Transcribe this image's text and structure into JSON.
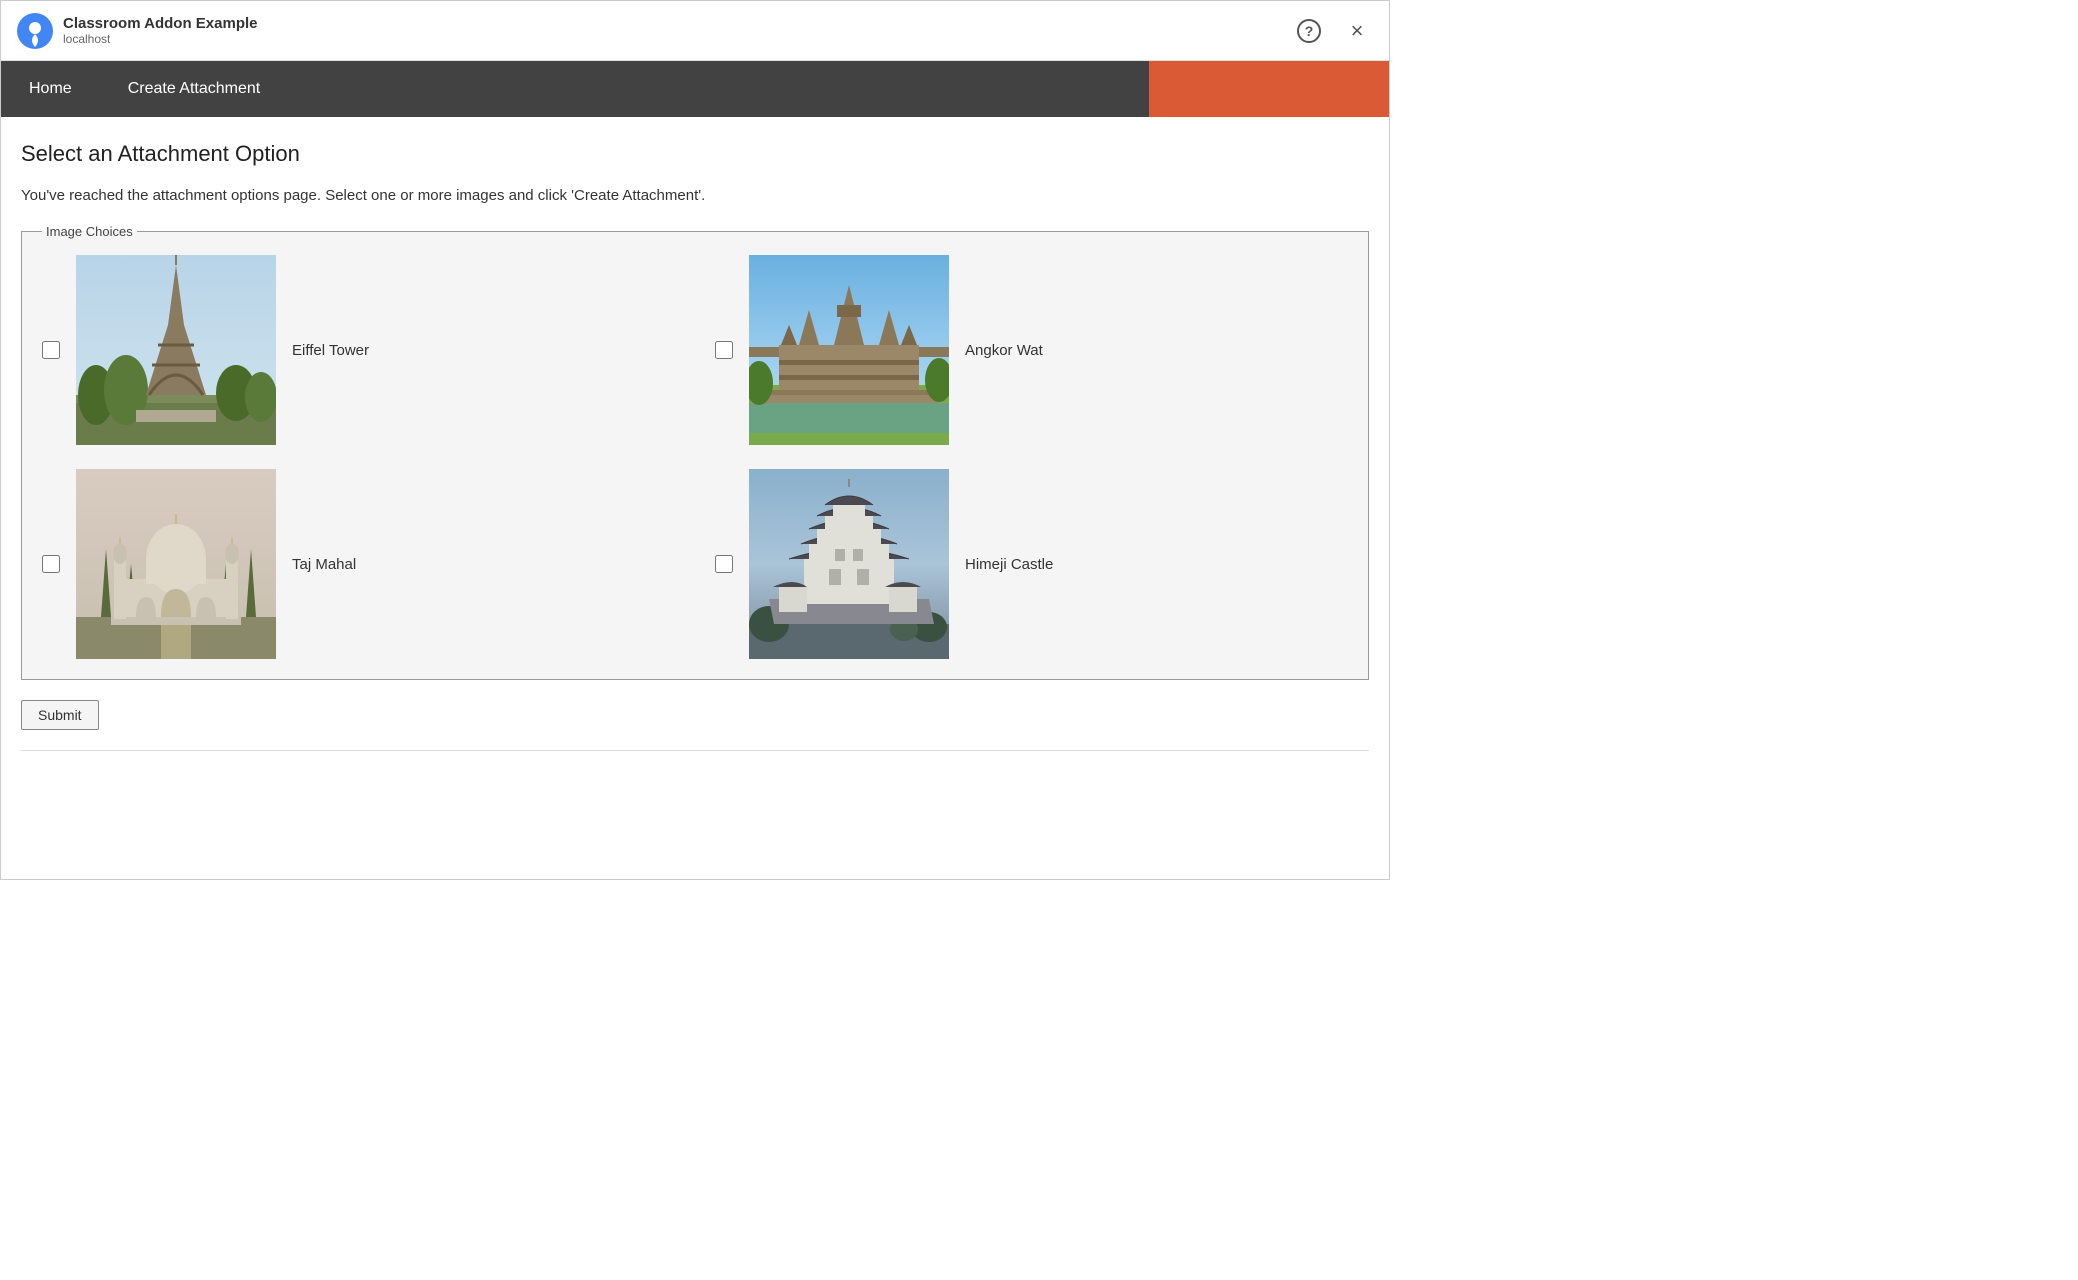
{
  "titleBar": {
    "appName": "Classroom Addon Example",
    "appSubtitle": "localhost",
    "helpLabel": "?",
    "closeLabel": "×"
  },
  "nav": {
    "items": [
      {
        "id": "home",
        "label": "Home"
      },
      {
        "id": "create-attachment",
        "label": "Create Attachment"
      }
    ],
    "accentColor": "#D95A34"
  },
  "page": {
    "title": "Select an Attachment Option",
    "description": "You've reached the attachment options page. Select one or more images and click 'Create Attachment'.",
    "fieldsetLabel": "Image Choices",
    "images": [
      {
        "id": "eiffel",
        "label": "Eiffel Tower",
        "checked": false
      },
      {
        "id": "angkor",
        "label": "Angkor Wat",
        "checked": false
      },
      {
        "id": "taj",
        "label": "Taj Mahal",
        "checked": false
      },
      {
        "id": "himeji",
        "label": "Himeji Castle",
        "checked": false
      }
    ],
    "submitLabel": "Submit"
  }
}
